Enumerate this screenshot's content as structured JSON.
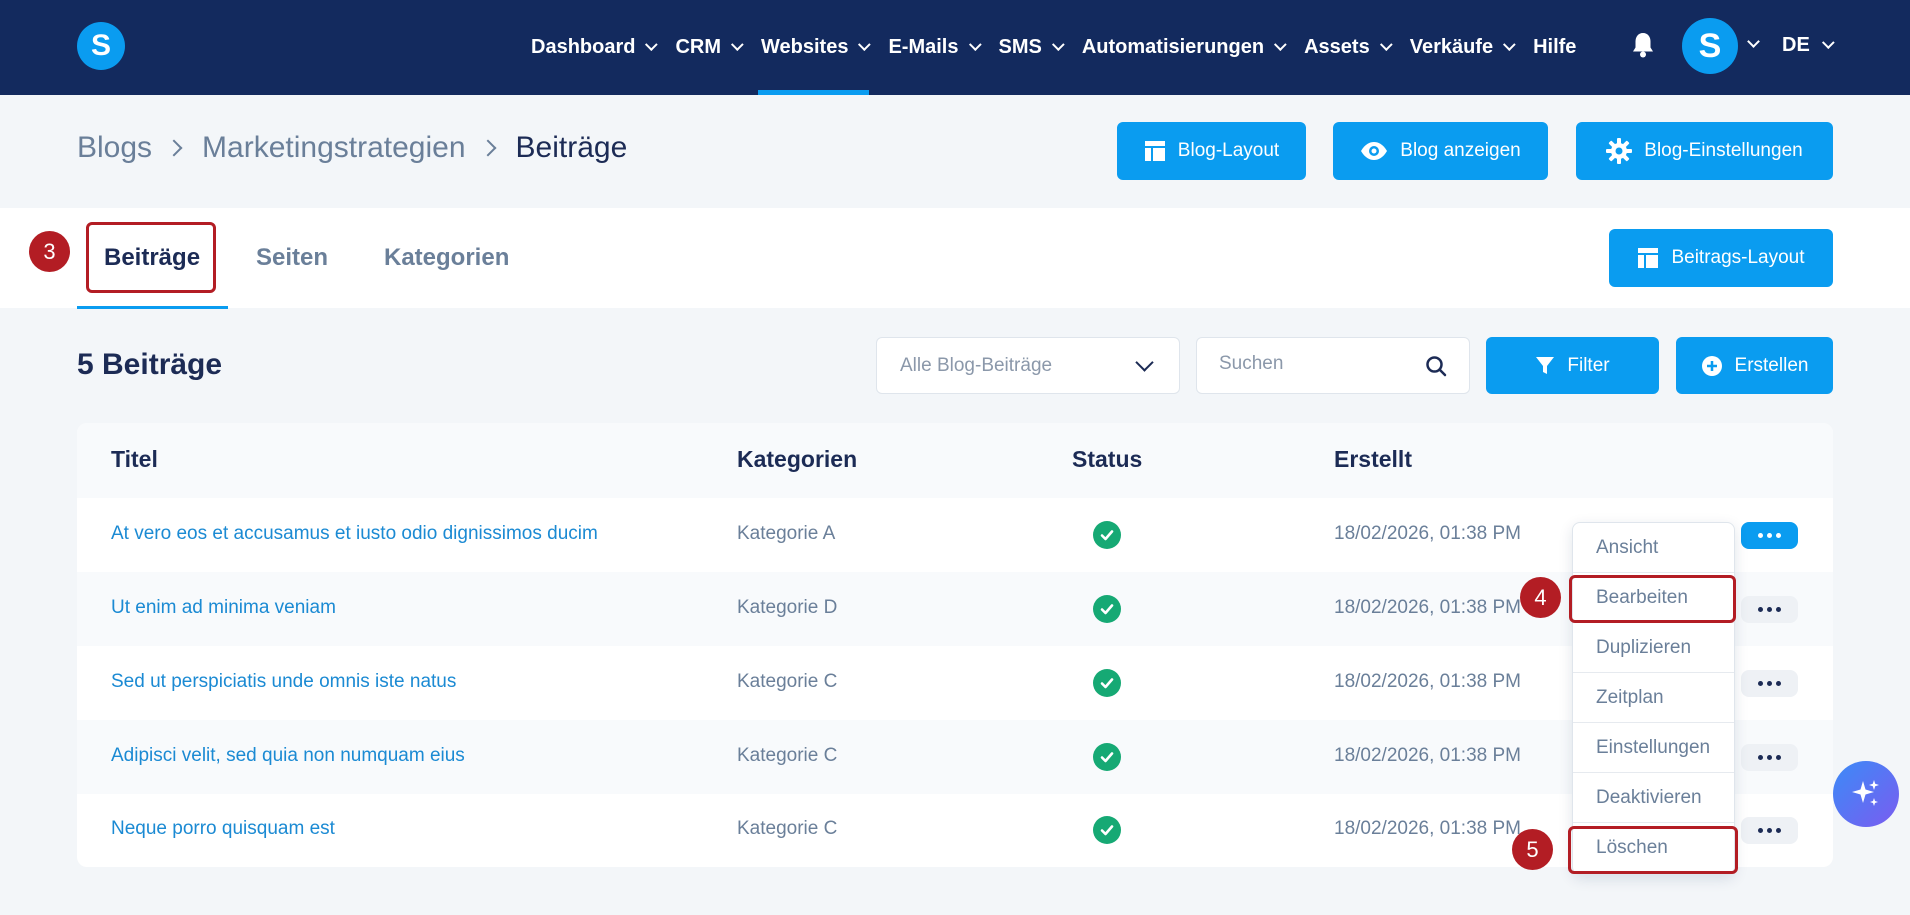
{
  "topnav": {
    "logo_letter": "S",
    "items": [
      {
        "label": "Dashboard",
        "has_menu": true
      },
      {
        "label": "CRM",
        "has_menu": true
      },
      {
        "label": "Websites",
        "has_menu": true,
        "active": true
      },
      {
        "label": "E-Mails",
        "has_menu": true
      },
      {
        "label": "SMS",
        "has_menu": true
      },
      {
        "label": "Automatisierungen",
        "has_menu": true
      },
      {
        "label": "Assets",
        "has_menu": true
      },
      {
        "label": "Verkäufe",
        "has_menu": true
      },
      {
        "label": "Hilfe",
        "has_menu": false
      }
    ],
    "avatar_letter": "S",
    "language": "DE"
  },
  "breadcrumb": {
    "items": [
      "Blogs",
      "Marketingstrategien",
      "Beiträge"
    ]
  },
  "header_buttons": {
    "layout": "Blog-Layout",
    "view": "Blog anzeigen",
    "settings": "Blog-Einstellungen"
  },
  "tabs": {
    "items": [
      "Beiträge",
      "Seiten",
      "Kategorien"
    ],
    "active": "Beiträge",
    "post_layout_button": "Beitrags-Layout"
  },
  "toolbar": {
    "count_title": "5 Beiträge",
    "filter_select": "Alle Blog-Beiträge",
    "search_placeholder": "Suchen",
    "filter_button": "Filter",
    "create_button": "Erstellen"
  },
  "table": {
    "columns": [
      "Titel",
      "Kategorien",
      "Status",
      "Erstellt"
    ],
    "rows": [
      {
        "title": "At vero eos et accusamus et iusto odio dignissimos ducim",
        "category": "Kategorie A",
        "status": "published",
        "created": "18/02/2026, 01:38 PM"
      },
      {
        "title": "Ut enim ad minima veniam",
        "category": "Kategorie D",
        "status": "published",
        "created": "18/02/2026, 01:38 PM"
      },
      {
        "title": "Sed ut perspiciatis unde omnis iste natus",
        "category": "Kategorie C",
        "status": "published",
        "created": "18/02/2026, 01:38 PM"
      },
      {
        "title": "Adipisci velit, sed quia non numquam eius",
        "category": "Kategorie C",
        "status": "published",
        "created": "18/02/2026, 01:38 PM"
      },
      {
        "title": "Neque porro quisquam est",
        "category": "Kategorie C",
        "status": "published",
        "created": "18/02/2026, 01:38 PM"
      }
    ]
  },
  "row_menu": {
    "items": [
      "Ansicht",
      "Bearbeiten",
      "Duplizieren",
      "Zeitplan",
      "Einstellungen",
      "Deaktivieren",
      "Löschen"
    ]
  },
  "annotations": {
    "marker_tab": "3",
    "marker_edit": "4",
    "marker_delete": "5"
  },
  "colors": {
    "nav_bg": "#132a5e",
    "accent": "#0a9cf0",
    "status_ok": "#16a974",
    "annotation_red": "#b31d24",
    "link": "#1b8ad3"
  }
}
